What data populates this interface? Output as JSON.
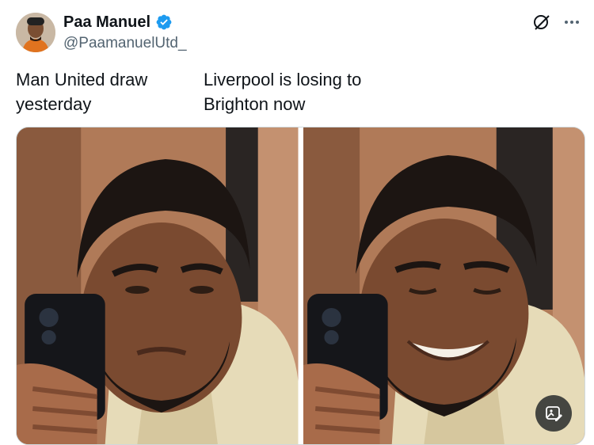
{
  "author": {
    "name": "Paa Manuel",
    "handle": "@PaamanuelUtd_",
    "verified_icon": "verified-badge-icon",
    "verified_color": "#1d9bf0"
  },
  "captions": {
    "left": "Man United draw yesterday",
    "right": "Liverpool is losing to Brighton now"
  },
  "icons": {
    "grok": "grok-icon",
    "more": "more-icon",
    "alt": "edit-image-icon"
  },
  "colors": {
    "text": "#0f1419",
    "secondary": "#536471",
    "border": "#cfd9de"
  }
}
